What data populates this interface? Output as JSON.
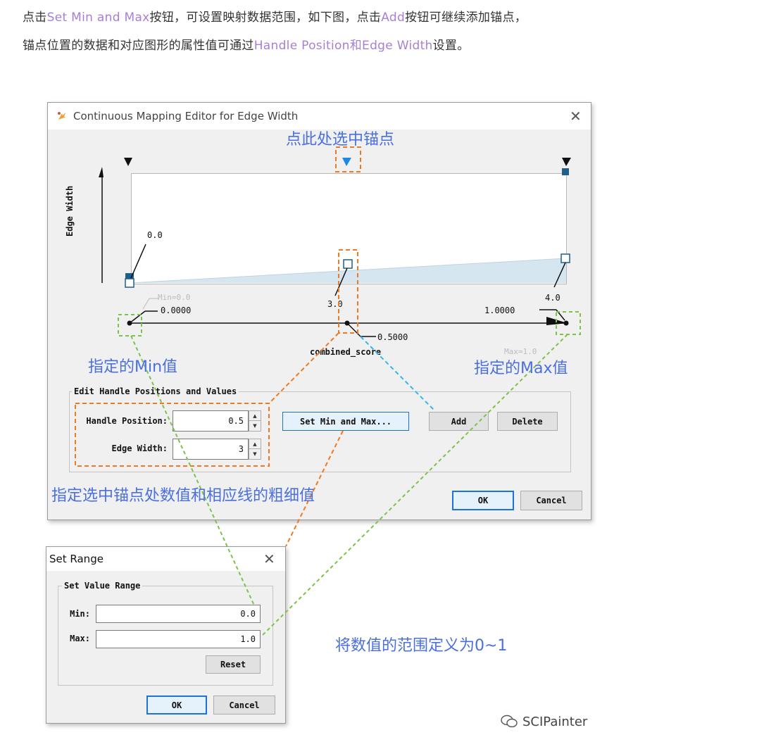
{
  "intro": {
    "line1": [
      {
        "t": "点击",
        "h": false
      },
      {
        "t": "Set Min and Max",
        "h": true
      },
      {
        "t": "按钮，可设置映射数据范围，如下图，点击",
        "h": false
      },
      {
        "t": "Add",
        "h": true
      },
      {
        "t": "按钮可继续添加锚点，",
        "h": false
      }
    ],
    "line2": [
      {
        "t": "锚点位置的数据和对应图形的属性值可通过",
        "h": false
      },
      {
        "t": "Handle Position和Edge Width",
        "h": true
      },
      {
        "t": "设置。",
        "h": false
      }
    ]
  },
  "main_dialog": {
    "title": "Continuous Mapping Editor for Edge Width",
    "close_glyph": "✕",
    "y_axis_label": "Edge Width",
    "x_axis_label": "combined_score",
    "handle_values": {
      "left": "0.0",
      "middle": "3.0",
      "right": "4.0"
    },
    "positions": {
      "left": "0.0000",
      "middle": "0.5000",
      "right": "1.0000"
    },
    "min_hint": "Min=0.0",
    "max_hint": "Max=1.0",
    "group_title": "Edit Handle Positions and Values",
    "handle_position_label": "Handle Position:",
    "handle_position_value": "0.5",
    "edge_width_label": "Edge Width:",
    "edge_width_value": "3",
    "set_min_max_button": "Set Min and Max...",
    "add_button": "Add",
    "delete_button": "Delete",
    "ok_button": "OK",
    "cancel_button": "Cancel",
    "spin_up": "▲",
    "spin_down": "▼"
  },
  "annotations": {
    "select_handle": "点此处选中锚点",
    "min_note": "指定的Min值",
    "max_note": "指定的Max值",
    "value_note": "指定选中锚点处数值和相应线的粗细值",
    "range_note": "将数值的范围定义为0~1"
  },
  "range_dialog": {
    "title": "Set Range",
    "close_glyph": "✕",
    "group_title": "Set Value Range",
    "min_label": "Min:",
    "min_value": "0.0",
    "max_label": "Max:",
    "max_value": "1.0",
    "reset_button": "Reset",
    "ok_button": "OK",
    "cancel_button": "Cancel"
  },
  "watermark": "SCIPainter",
  "colors": {
    "highlight_text": "#a97fd6",
    "annotation_blue": "#4a6fe0",
    "orange_dash": "#f07a23",
    "green_dash": "#7dc24b",
    "cyan_dash": "#35b8e8",
    "handle_selected": "#1e88e5",
    "handle_dark": "#1f5f8b",
    "area_fill": "#d6e6f0"
  }
}
